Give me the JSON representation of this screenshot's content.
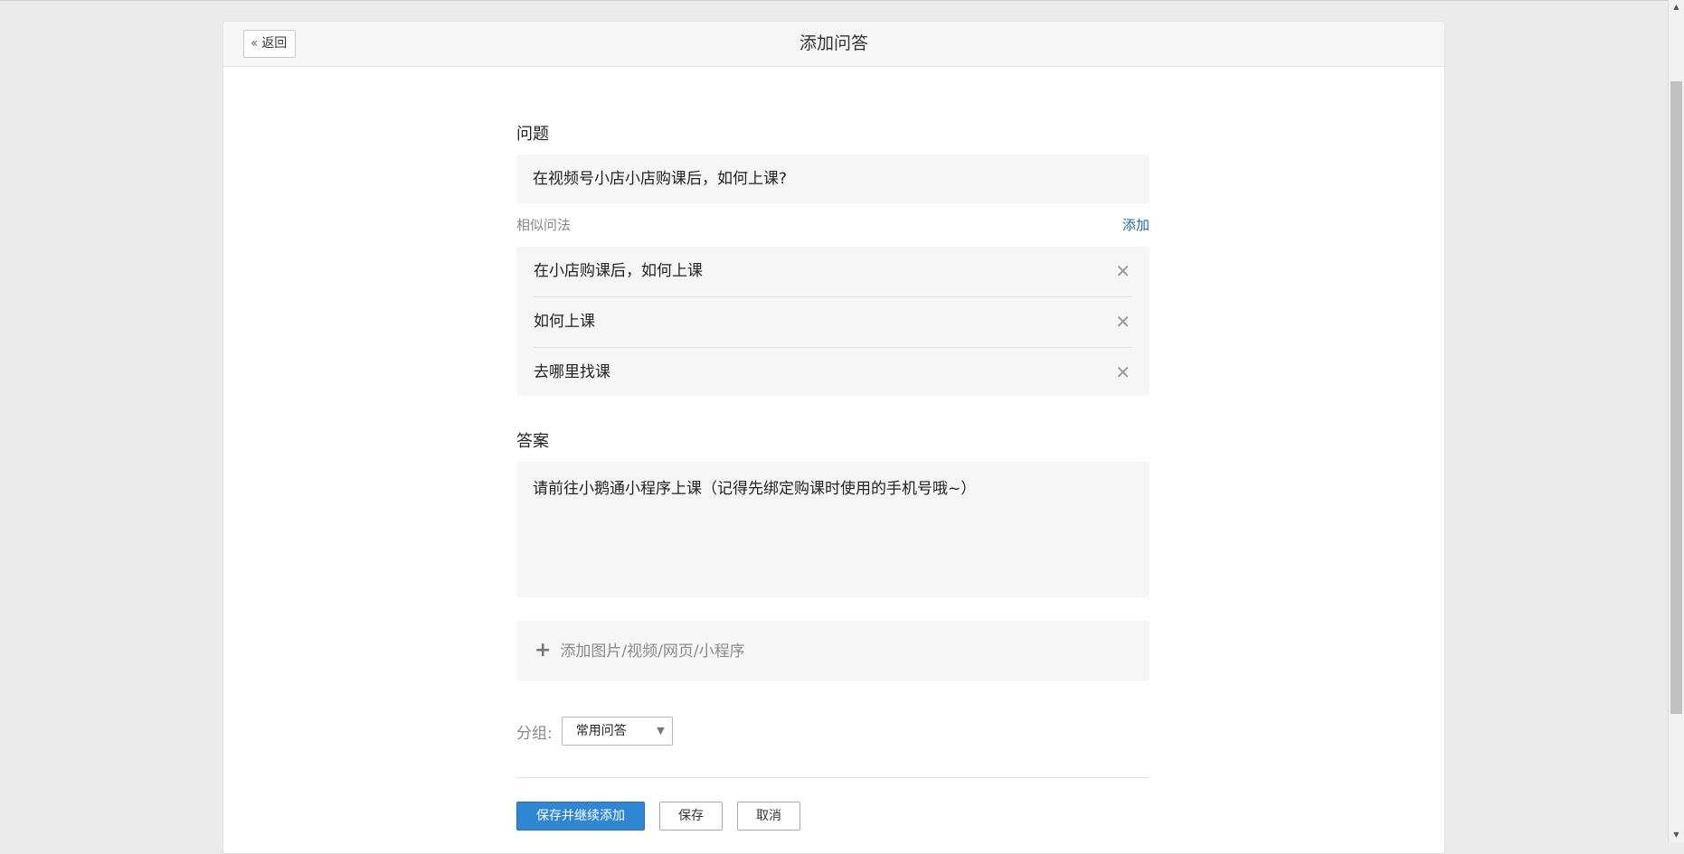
{
  "header": {
    "back_label": "返回",
    "title": "添加问答"
  },
  "question": {
    "label": "问题",
    "value": "在视频号小店小店购课后，如何上课?"
  },
  "similar": {
    "label": "相似问法",
    "add_label": "添加",
    "items": [
      {
        "text": "在小店购课后，如何上课"
      },
      {
        "text": "如何上课"
      },
      {
        "text": "去哪里找课"
      }
    ]
  },
  "answer": {
    "label": "答案",
    "value": "请前往小鹅通小程序上课（记得先绑定购课时使用的手机号哦~）"
  },
  "media": {
    "label": "添加图片/视频/网页/小程序"
  },
  "group": {
    "label": "分组:",
    "selected": "常用问答"
  },
  "actions": {
    "save_continue": "保存并继续添加",
    "save": "保存",
    "cancel": "取消"
  },
  "colors": {
    "primary": "#2f86d3",
    "link": "#1d6aa8"
  }
}
